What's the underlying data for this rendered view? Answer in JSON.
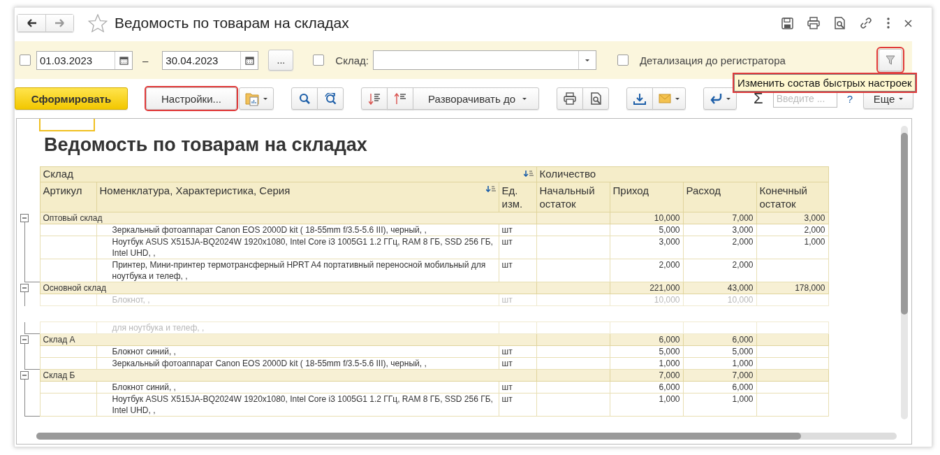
{
  "window": {
    "title": "Ведомость по товарам на складах",
    "favorite": false
  },
  "filters": {
    "period_checked": false,
    "date_from": "01.03.2023",
    "dash": "–",
    "date_to": "30.04.2023",
    "period_button": "...",
    "warehouse_checked": false,
    "warehouse_label": "Склад:",
    "detail_checked": false,
    "detail_label": "Детализация до регистратора",
    "quick_settings_highlighted": true
  },
  "toolbar": {
    "generate": "Сформировать",
    "settings": {
      "label": "Настройки...",
      "highlighted": true
    },
    "expand": "Разворачивать до",
    "sigma": "Σ",
    "search_placeholder": "Введите ...",
    "help": "?",
    "more": "Еще"
  },
  "tooltip": {
    "text": "Изменить состав быстрых настроек",
    "highlighted": true
  },
  "report": {
    "title": "Ведомость по товарам на складах",
    "header": {
      "group": "Склад",
      "quantity": "Количество",
      "article": "Артикул",
      "item": "Номенклатура, Характеристика, Серия",
      "unit": "Ед. изм.",
      "start": "Начальный остаток",
      "in": "Приход",
      "out": "Расход",
      "end": "Конечный остаток"
    },
    "groups": [
      {
        "name": "Оптовый склад",
        "expanded": true,
        "in": "10,000",
        "out": "7,000",
        "end": "3,000",
        "rows": [
          {
            "kind": "item",
            "faded": false,
            "name": "Зеркальный фотоаппарат Canon EOS 2000D kit ( 18-55mm f/3.5-5.6 III), черный, ,",
            "unit": "шт",
            "in": "5,000",
            "out": "3,000",
            "end": "2,000"
          },
          {
            "kind": "item",
            "faded": false,
            "name": "Ноутбук ASUS X515JA-BQ2024W 1920x1080, Intel Core i3 1005G1 1.2 ГГц, RAM 8 ГБ, SSD 256 ГБ, Intel UHD, ,",
            "unit": "шт",
            "in": "3,000",
            "out": "2,000",
            "end": "1,000"
          },
          {
            "kind": "item",
            "faded": false,
            "name": "Принтер, Мини-принтер термотрансферный HPRT A4 портативный переносной мобильный для ноутбука и телеф, ,",
            "unit": "шт",
            "in": "2,000",
            "out": "2,000"
          }
        ]
      },
      {
        "name": "Основной склад",
        "expanded": true,
        "in": "221,000",
        "out": "43,000",
        "end": "178,000",
        "rows": [
          {
            "kind": "item",
            "faded": true,
            "name": "Блокнот, ,",
            "unit": "шт",
            "in": "10,000",
            "out": "10,000"
          },
          {
            "kind": "gap"
          },
          {
            "kind": "item",
            "faded": true,
            "name": "для ноутбука и телеф, ,"
          }
        ]
      },
      {
        "name": "Склад А",
        "expanded": true,
        "in": "6,000",
        "out": "6,000",
        "rows": [
          {
            "kind": "item",
            "faded": false,
            "name": "Блокнот синий, ,",
            "unit": "шт",
            "in": "5,000",
            "out": "5,000"
          },
          {
            "kind": "item",
            "faded": false,
            "name": "Зеркальный фотоаппарат Canon EOS 2000D kit ( 18-55mm f/3.5-5.6 III), черный, ,",
            "unit": "шт",
            "in": "1,000",
            "out": "1,000"
          }
        ]
      },
      {
        "name": "Склад Б",
        "expanded": true,
        "in": "7,000",
        "out": "7,000",
        "rows": [
          {
            "kind": "item",
            "faded": false,
            "name": "Блокнот синий, ,",
            "unit": "шт",
            "in": "6,000",
            "out": "6,000"
          },
          {
            "kind": "item",
            "faded": false,
            "name": "Ноутбук ASUS X515JA-BQ2024W 1920x1080, Intel Core i3 1005G1 1.2 ГГц, RAM 8 ГБ, SSD 256 ГБ, Intel UHD, ,",
            "unit": "шт",
            "in": "1,000",
            "out": "1,000"
          }
        ]
      }
    ]
  }
}
